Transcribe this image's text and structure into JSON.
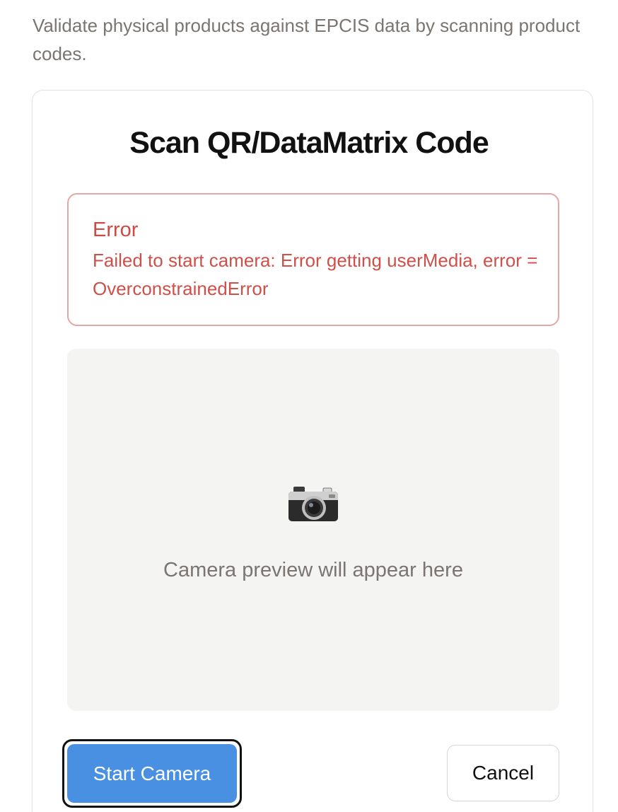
{
  "intro": {
    "text": "Validate physical products against EPCIS data by scanning product codes."
  },
  "scanner": {
    "title": "Scan QR/DataMatrix Code",
    "error": {
      "title": "Error",
      "message": "Failed to start camera: Error getting userMedia, error = OverconstrainedError"
    },
    "preview": {
      "icon": "camera-icon",
      "text": "Camera preview will appear here"
    },
    "actions": {
      "start_label": "Start Camera",
      "cancel_label": "Cancel"
    }
  },
  "colors": {
    "primary": "#4a90e2",
    "error": "#d14f49",
    "error_border": "#e6a6a3",
    "muted_text": "#7a7570",
    "preview_bg": "#f4f4f3"
  }
}
